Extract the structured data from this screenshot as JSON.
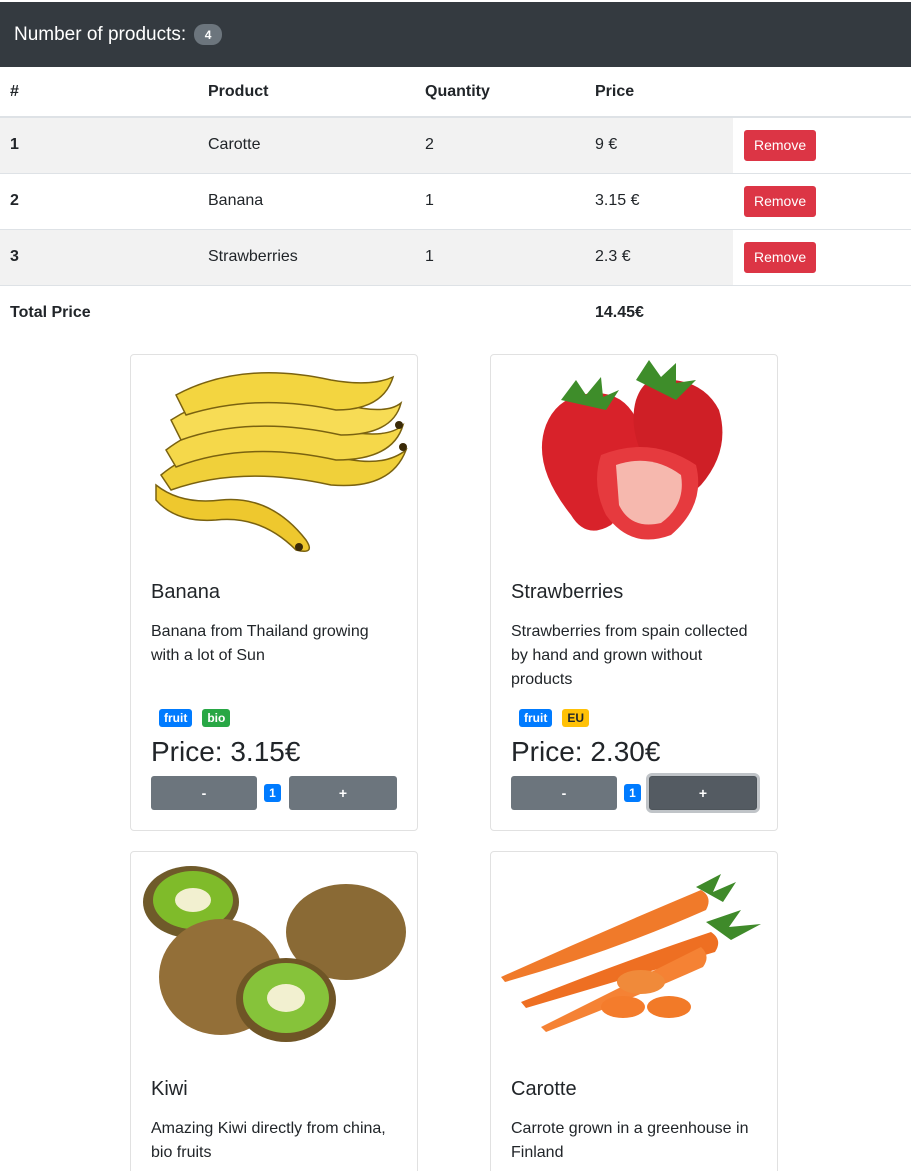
{
  "navbar": {
    "title": "Number of products:",
    "count": "4"
  },
  "cart": {
    "headers": [
      "#",
      "Product",
      "Quantity",
      "Price"
    ],
    "rows": [
      {
        "index": "1",
        "product": "Carotte",
        "quantity": "2",
        "price": "9 €",
        "action": "Remove"
      },
      {
        "index": "2",
        "product": "Banana",
        "quantity": "1",
        "price": "3.15 €",
        "action": "Remove"
      },
      {
        "index": "3",
        "product": "Strawberries",
        "quantity": "1",
        "price": "2.3 €",
        "action": "Remove"
      }
    ],
    "total_label": "Total Price",
    "total_value": "14.45€"
  },
  "products": [
    {
      "title": "Banana",
      "description": "Banana from Thailand growing with a lot of Sun",
      "tags": [
        "fruit",
        "bio"
      ],
      "price": "Price: 3.15€",
      "minus": "-",
      "plus": "+",
      "quantity": "1",
      "image_icon": "banana-image"
    },
    {
      "title": "Strawberries",
      "description": "Strawberries from spain collected by hand and grown without products",
      "tags": [
        "fruit",
        "EU"
      ],
      "price": "Price: 2.30€",
      "minus": "-",
      "plus": "+",
      "quantity": "1",
      "image_icon": "strawberry-image"
    },
    {
      "title": "Kiwi",
      "description": "Amazing Kiwi directly from china, bio fruits",
      "image_icon": "kiwi-image"
    },
    {
      "title": "Carotte",
      "description": "Carrote grown in a greenhouse in Finland",
      "image_icon": "carrot-image"
    }
  ],
  "colors": {
    "navbar": "#343a40",
    "remove": "#dc3545",
    "fruit_tag": "#007bff",
    "bio_tag": "#28a745",
    "eu_tag": "#ffc107",
    "qty_button": "#6c757d"
  }
}
